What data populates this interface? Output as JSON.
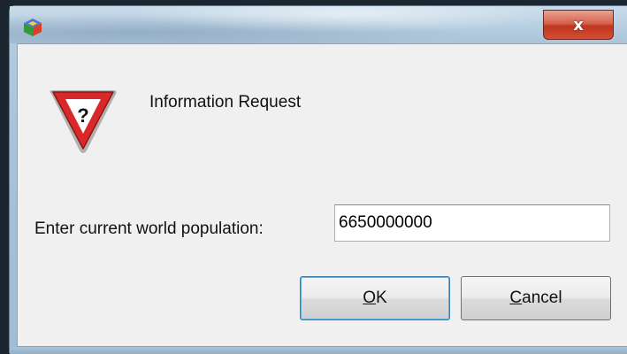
{
  "window": {
    "title": "",
    "app_icon": "java-duke-cube-icon",
    "close_label": "x"
  },
  "dialog": {
    "header": "Information Request",
    "icon": "question-warning-triangle-icon",
    "icon_glyph": "?",
    "prompt": "Enter current world population:",
    "input_value": "6650000000",
    "ok_mnemonic": "O",
    "ok_rest": "K",
    "cancel_mnemonic": "C",
    "cancel_rest": "ancel"
  },
  "colors": {
    "warning_red": "#d9282a",
    "close_red": "#c0351f",
    "client_bg": "#f0f0f0"
  }
}
